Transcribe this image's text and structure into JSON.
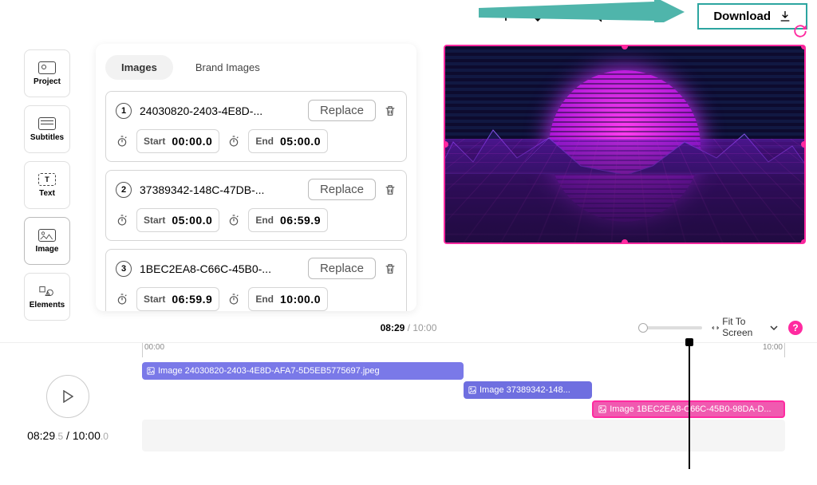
{
  "topbar": {
    "download_label": "Download"
  },
  "rail": {
    "items": [
      "Project",
      "Subtitles",
      "Text",
      "Image",
      "Elements"
    ],
    "active_index": 3
  },
  "panel": {
    "tabs": {
      "images": "Images",
      "brand": "Brand Images"
    },
    "cards": [
      {
        "num": "1",
        "name": "24030820-2403-4E8D-...",
        "start_label": "Start",
        "start": "00:00.0",
        "end_label": "End",
        "end": "05:00.0",
        "replace": "Replace"
      },
      {
        "num": "2",
        "name": "37389342-148C-47DB-...",
        "start_label": "Start",
        "start": "05:00.0",
        "end_label": "End",
        "end": "06:59.9",
        "replace": "Replace"
      },
      {
        "num": "3",
        "name": "1BEC2EA8-C66C-45B0-...",
        "start_label": "Start",
        "start": "06:59.9",
        "end_label": "End",
        "end": "10:00.0",
        "replace": "Replace"
      }
    ]
  },
  "midrow": {
    "current": "08:29",
    "total": "10:00",
    "fit": "Fit To Screen",
    "help": "?"
  },
  "timeline": {
    "play_current": "08:29",
    "play_current_dec": ".5",
    "play_total": "10:00",
    "play_total_dec": ".0",
    "ruler_start": "00:00",
    "ruler_end": "10:00",
    "clips": [
      {
        "label": "Image 24030820-2403-4E8D-AFA7-5D5EB5775697.jpeg",
        "left_pct": 0,
        "width_pct": 50,
        "row": 0,
        "cls": "c1"
      },
      {
        "label": "Image 37389342-148...",
        "left_pct": 50,
        "width_pct": 20,
        "row": 1,
        "cls": "c2"
      },
      {
        "label": "Image 1BEC2EA8-C66C-45B0-98DA-D...",
        "left_pct": 70,
        "width_pct": 30,
        "row": 2,
        "cls": "c3"
      }
    ],
    "playhead_pct": 85
  }
}
